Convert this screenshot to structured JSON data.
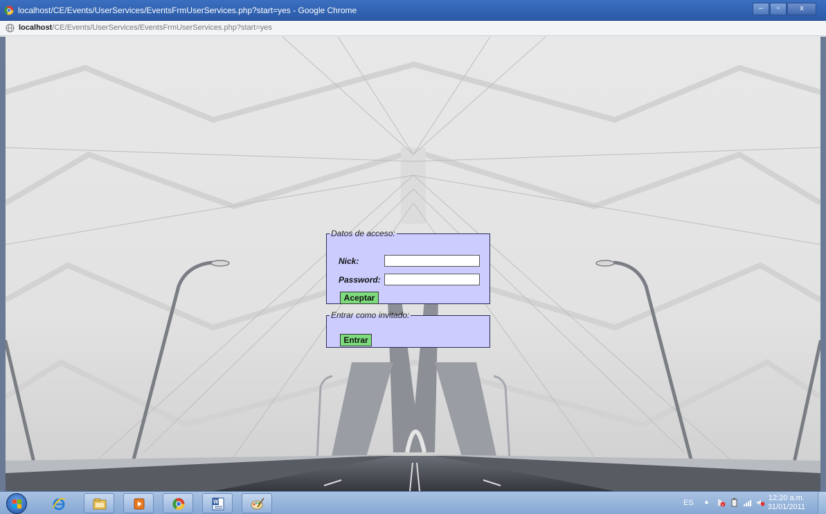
{
  "window": {
    "title": "localhost/CE/Events/UserServices/EventsFrmUserServices.php?start=yes - Google Chrome",
    "controls": {
      "minimize": "–",
      "maximize": "▫",
      "close": "x"
    }
  },
  "address": {
    "host": "localhost",
    "path": "/CE/Events/UserServices/EventsFrmUserServices.php?start=yes"
  },
  "login_form": {
    "legend": "Datos de acceso:",
    "nick_label": "Nick:",
    "nick_value": "",
    "password_label": "Password:",
    "password_value": "",
    "submit_label": "Aceptar"
  },
  "guest_form": {
    "legend": "Entrar como invitado:",
    "submit_label": "Entrar"
  },
  "taskbar": {
    "items": [
      "internet-explorer",
      "file-explorer",
      "media-player",
      "google-chrome",
      "microsoft-word",
      "paint"
    ],
    "language": "ES",
    "time": "12:20 a.m.",
    "date": "31/01/2011"
  },
  "colors": {
    "form_background": "#ccccff",
    "button_background": "#7ddc7d",
    "titlebar": "#2a5aa8"
  }
}
